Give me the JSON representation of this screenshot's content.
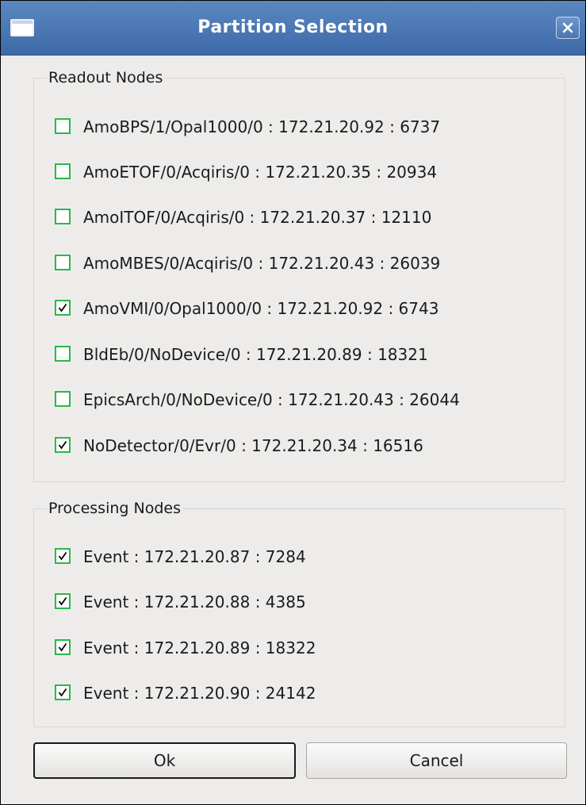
{
  "window": {
    "title": "Partition Selection"
  },
  "readout": {
    "title": "Readout Nodes",
    "items": [
      {
        "label": "AmoBPS/1/Opal1000/0 : 172.21.20.92 : 6737",
        "checked": false
      },
      {
        "label": "AmoETOF/0/Acqiris/0 : 172.21.20.35 : 20934",
        "checked": false
      },
      {
        "label": "AmoITOF/0/Acqiris/0 : 172.21.20.37 : 12110",
        "checked": false
      },
      {
        "label": "AmoMBES/0/Acqiris/0 : 172.21.20.43 : 26039",
        "checked": false
      },
      {
        "label": "AmoVMI/0/Opal1000/0 : 172.21.20.92 : 6743",
        "checked": true
      },
      {
        "label": "BldEb/0/NoDevice/0 : 172.21.20.89 : 18321",
        "checked": false
      },
      {
        "label": "EpicsArch/0/NoDevice/0 : 172.21.20.43 : 26044",
        "checked": false
      },
      {
        "label": "NoDetector/0/Evr/0 : 172.21.20.34 : 16516",
        "checked": true
      }
    ]
  },
  "processing": {
    "title": "Processing Nodes",
    "items": [
      {
        "label": "Event : 172.21.20.87 : 7284",
        "checked": true
      },
      {
        "label": "Event : 172.21.20.88 : 4385",
        "checked": true
      },
      {
        "label": "Event : 172.21.20.89 : 18322",
        "checked": true
      },
      {
        "label": "Event : 172.21.20.90 : 24142",
        "checked": true
      }
    ]
  },
  "buttons": {
    "ok": "Ok",
    "cancel": "Cancel"
  },
  "colors": {
    "titlebar": "#4a77b5",
    "checkbox_border": "#29b84a",
    "check_mark": "#000000",
    "window_bg": "#edeceb"
  },
  "icons": {
    "window_menu": "window-menu-icon",
    "close": "close-icon",
    "check": "check-icon"
  }
}
